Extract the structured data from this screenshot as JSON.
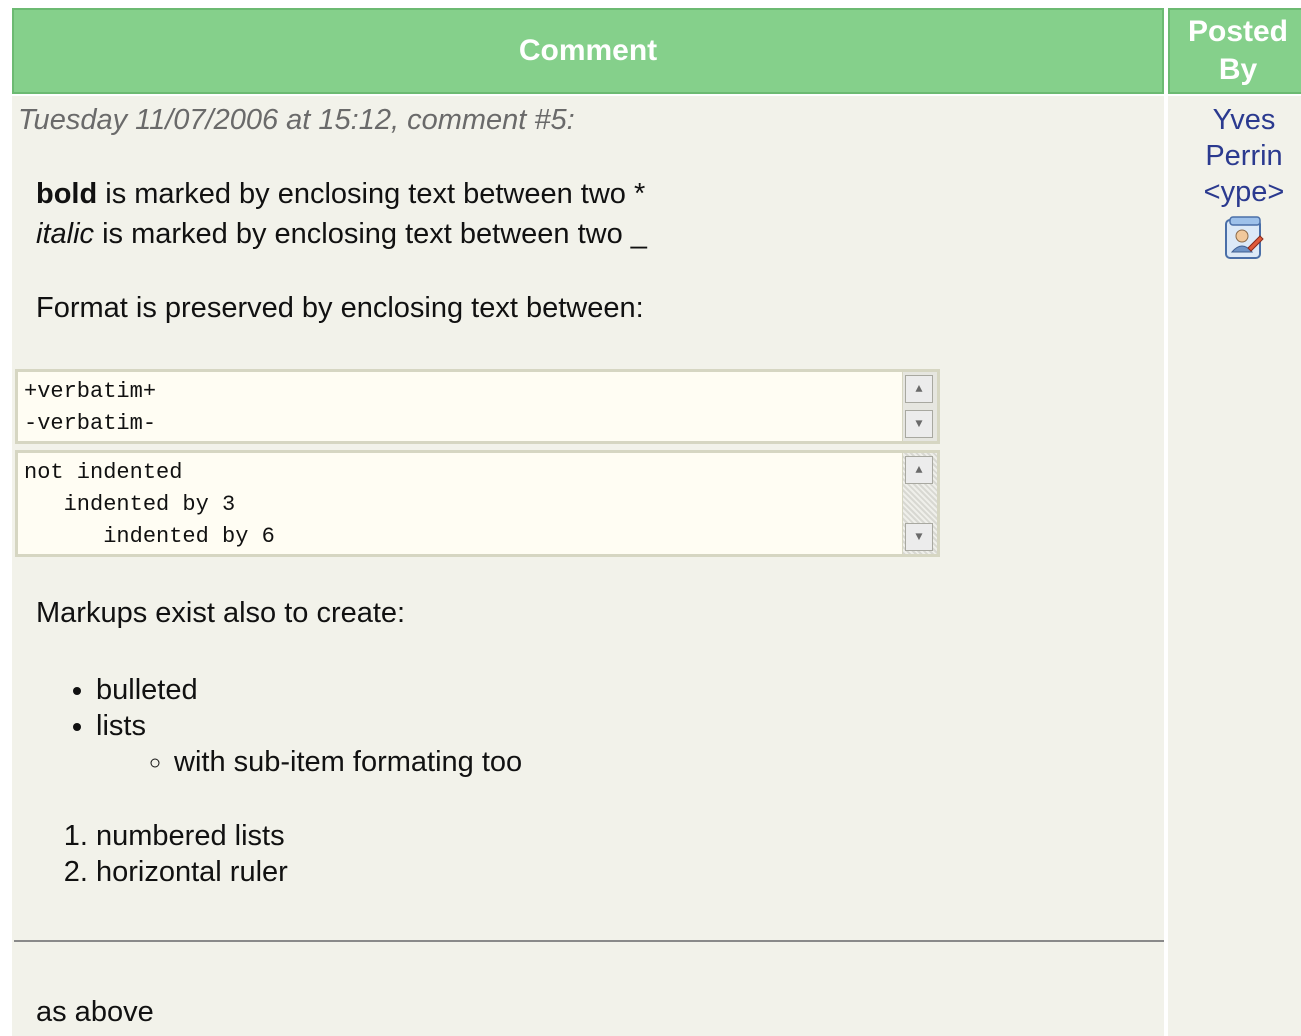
{
  "header": {
    "comment_label": "Comment",
    "posted_by_label": "Posted By"
  },
  "comment": {
    "meta": "Tuesday 11/07/2006 at 15:12, comment #5:",
    "bold_word": "bold",
    "bold_line_rest": " is marked by enclosing text between two *",
    "italic_word": "italic",
    "italic_line_rest": " is marked by enclosing text between two _",
    "format_line": "Format is preserved by enclosing text between:",
    "verbatim_box": "+verbatim+\n-verbatim-",
    "indent_box": "not indented\n   indented by 3\n      indented by 6",
    "markups_line": "Markups exist also to create:",
    "bullets": [
      "bulleted",
      "lists"
    ],
    "sub_bullets": [
      "with sub-item formating too"
    ],
    "numbered": [
      "numbered lists",
      "horizontal ruler"
    ],
    "after_rule": "as above"
  },
  "author": {
    "first": "Yves",
    "last": "Perrin",
    "handle": "<ype>",
    "icon": "contact-card-icon"
  }
}
